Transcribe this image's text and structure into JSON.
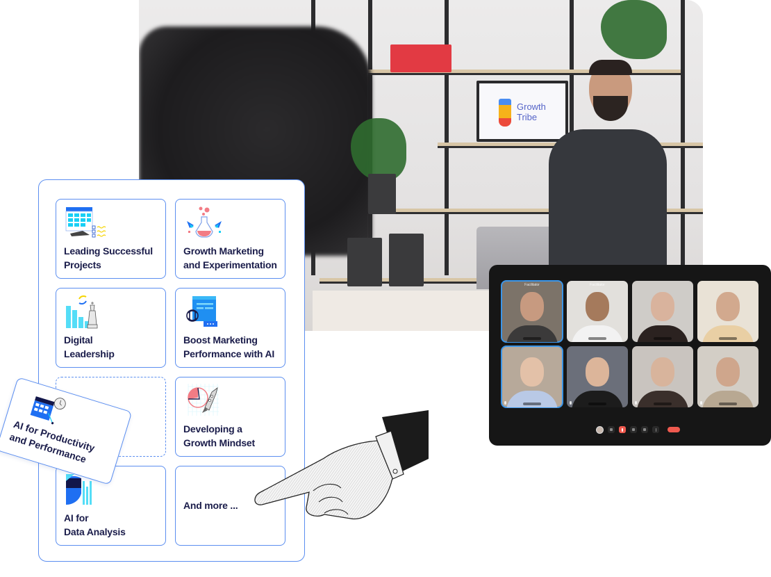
{
  "hero_photo": {
    "alt": "Instructor presenting in a studio in front of shelves",
    "screen_brand": "Growth\nTribe"
  },
  "course_panel": {
    "courses": [
      {
        "title": "Leading Successful\nProjects",
        "icon": "project-calendar-icon"
      },
      {
        "title": "Growth Marketing\nand Experimentation",
        "icon": "lab-flask-icon"
      },
      {
        "title": "Digital\nLeadership",
        "icon": "chess-chart-icon"
      },
      {
        "title": "Boost Marketing\nPerformance with AI",
        "icon": "ai-dashboard-icon"
      },
      {
        "title": "",
        "icon": "empty-slot",
        "placeholder": true
      },
      {
        "title": "Developing a\nGrowth Mindset",
        "icon": "rocket-pie-icon"
      },
      {
        "title": "AI for\nData Analysis",
        "icon": "data-chart-icon"
      },
      {
        "title": "And more ...",
        "icon": ""
      }
    ],
    "dragged_course": {
      "title": "AI for Productivity\nand Performance",
      "icon": "calendar-clock-icon"
    }
  },
  "colors": {
    "accent_blue": "#5b8ef0",
    "text_navy": "#1a1c4a",
    "call_bg": "#161616",
    "active_speaker": "#3b95e8",
    "leave_red": "#ef5a4f"
  },
  "video_call": {
    "participants": [
      {
        "role": "Facilitator",
        "active": true,
        "skin": "#c79a80",
        "shirt": "#3b3a3a",
        "bg": "#7c7369"
      },
      {
        "role": "Facilitator",
        "active": false,
        "skin": "#a57a5c",
        "shirt": "#f2f2f2",
        "bg": "#e2e0dc"
      },
      {
        "role": "",
        "active": false,
        "skin": "#d9b39d",
        "shirt": "#2b2220",
        "bg": "#cfccc8"
      },
      {
        "role": "",
        "active": false,
        "skin": "#d2a98e",
        "shirt": "#e9cfa4",
        "bg": "#e9e2d6"
      },
      {
        "role": "",
        "active": true,
        "skin": "#e3c1a8",
        "shirt": "#b9c9e6",
        "bg": "#b7a99a"
      },
      {
        "role": "",
        "active": false,
        "skin": "#dcb59a",
        "shirt": "#1c1c1c",
        "bg": "#6b6f7a"
      },
      {
        "role": "",
        "active": false,
        "skin": "#d8b49c",
        "shirt": "#3a2f2b",
        "bg": "#c9c4bf"
      },
      {
        "role": "",
        "active": false,
        "skin": "#cfa68c",
        "shirt": "#b8a892",
        "bg": "#d3cec6"
      }
    ],
    "controls": [
      "self-avatar",
      "camera",
      "microphone",
      "raise-hand",
      "emoji",
      "more"
    ]
  }
}
